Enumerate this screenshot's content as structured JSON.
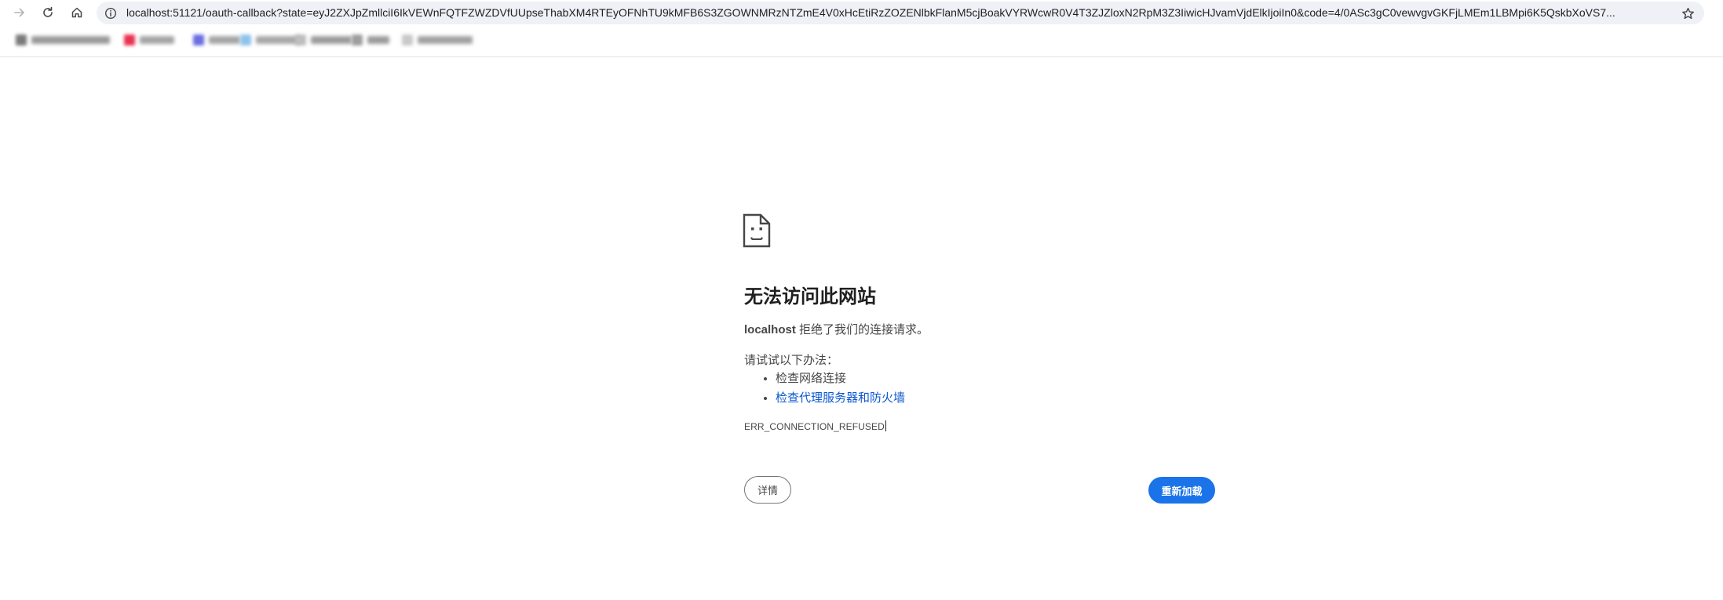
{
  "browser": {
    "url": "localhost:51121/oauth-callback?state=eyJ2ZXJpZmllciI6IkVEWnFQTFZWZDVfUUpseThabXM4RTEyOFNhTU9kMFB6S3ZGOWNMRzNTZmE4V0xHcEtiRzZOZENlbkFlanM5cjBoakVYRWcwR0V4T3ZJZloxN2RpM3Z3IiwicHJvamVjdElkIjoiIn0&code=4/0ASc3gC0vewvgvGKFjLMEm1LBMpi6K5QskbXoVS7..."
  },
  "error_page": {
    "title": "无法访问此网站",
    "host": "localhost",
    "description_suffix": " 拒绝了我们的连接请求。",
    "suggestions_heading": "请试试以下办法：",
    "suggestions": [
      "检查网络连接",
      "检查代理服务器和防火墙"
    ],
    "error_code": "ERR_CONNECTION_REFUSED",
    "details_button": "详情",
    "reload_button": "重新加载"
  },
  "colors": {
    "accent": "#1a73e8",
    "link": "#0b57d0",
    "omnibox_bg": "#eef1f6"
  }
}
